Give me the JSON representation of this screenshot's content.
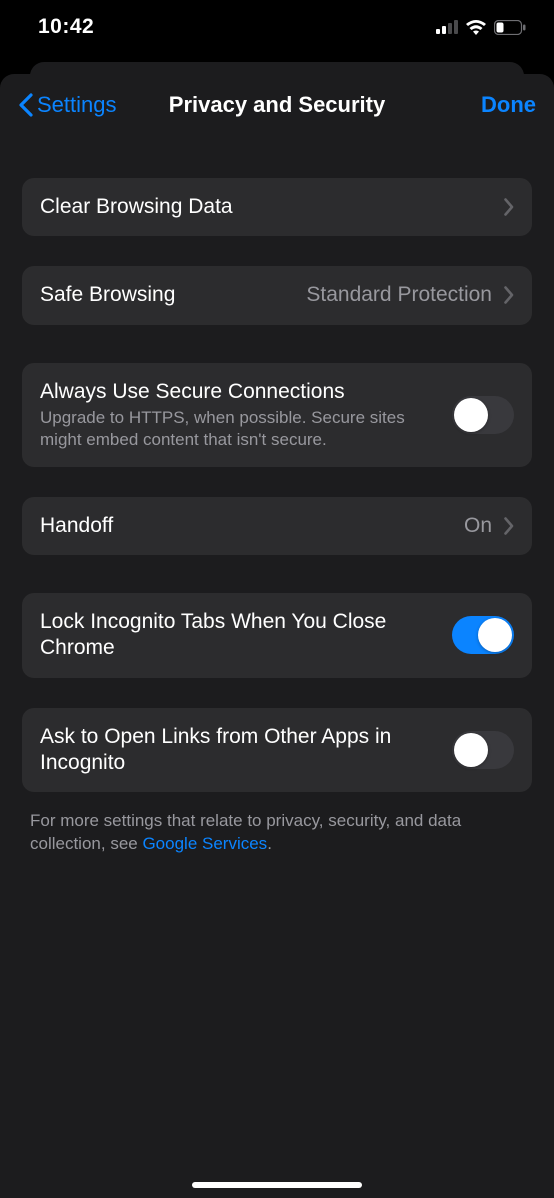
{
  "status": {
    "time": "10:42"
  },
  "nav": {
    "back": "Settings",
    "title": "Privacy and Security",
    "done": "Done"
  },
  "rows": {
    "clear_browsing": "Clear Browsing Data",
    "safe_browsing_label": "Safe Browsing",
    "safe_browsing_value": "Standard Protection",
    "secure_conn_label": "Always Use Secure Connections",
    "secure_conn_sub": "Upgrade to HTTPS, when possible. Secure sites might embed content that isn't secure.",
    "handoff_label": "Handoff",
    "handoff_value": "On",
    "lock_incognito": "Lock Incognito Tabs When You Close Chrome",
    "ask_open_links": "Ask to Open Links from Other Apps in Incognito"
  },
  "footer": {
    "text_before": "For more settings that relate to privacy, security, and data collection, see ",
    "link": "Google Services",
    "text_after": "."
  },
  "toggles": {
    "secure_conn": false,
    "lock_incognito": true,
    "ask_open_links": false
  }
}
